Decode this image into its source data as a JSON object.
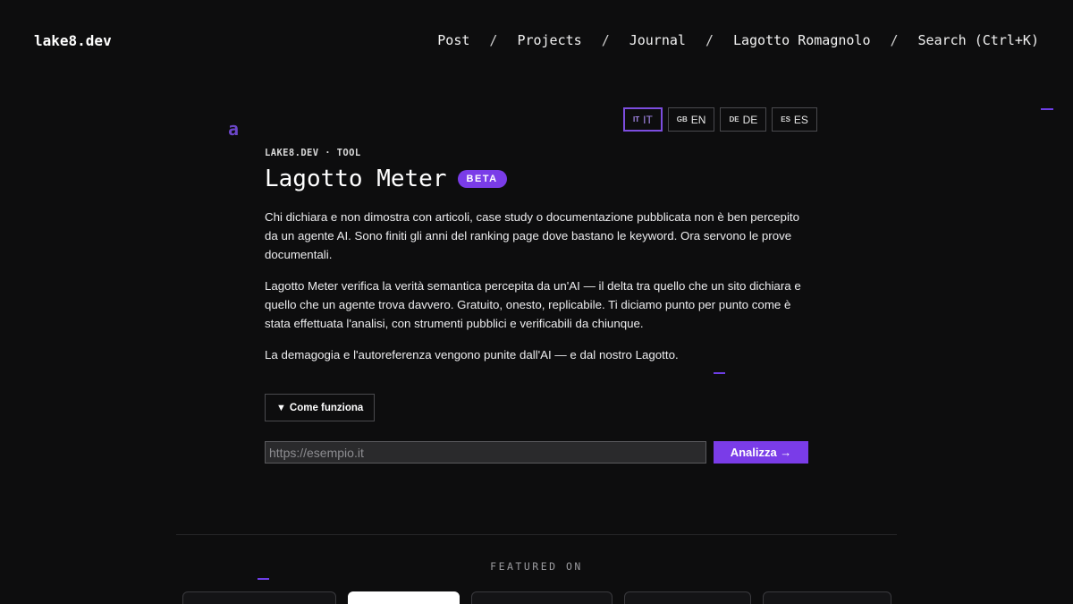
{
  "header": {
    "logo": "lake8.dev",
    "nav": [
      {
        "label": "Post"
      },
      {
        "label": "Projects"
      },
      {
        "label": "Journal"
      },
      {
        "label": "Lagotto Romagnolo"
      },
      {
        "label": "Search (Ctrl+K)"
      }
    ],
    "separator": "/"
  },
  "decor": {
    "letter": "a",
    "accent_color": "#7a3ce8"
  },
  "languages": [
    {
      "code": "IT",
      "label": "IT",
      "active": true
    },
    {
      "code": "GB",
      "label": "EN",
      "active": false
    },
    {
      "code": "DE",
      "label": "DE",
      "active": false
    },
    {
      "code": "ES",
      "label": "ES",
      "active": false
    }
  ],
  "main": {
    "eyebrow": "LAKE8.DEV · TOOL",
    "title": "Lagotto Meter",
    "badge": "BETA",
    "paragraphs": [
      "Chi dichiara e non dimostra con articoli, case study o documentazione pubblicata non è ben percepito da un agente AI. Sono finiti gli anni del ranking page dove bastano le keyword. Ora servono le prove documentali.",
      "Lagotto Meter verifica la verità semantica percepita da un'AI — il delta tra quello che un sito dichiara e quello che un agente trova davvero. Gratuito, onesto, replicabile. Ti diciamo punto per punto come è stata effettuata l'analisi, con strumenti pubblici e verificabili da chiunque.",
      "La demagogia e l'autoreferenza vengono punite dall'AI — e dal nostro Lagotto."
    ],
    "how_it_works": "Come funziona",
    "url_input": {
      "value": "",
      "placeholder": "https://esempio.it"
    },
    "analyze_button": "Analizza →"
  },
  "featured": {
    "heading": "FEATURED ON"
  }
}
